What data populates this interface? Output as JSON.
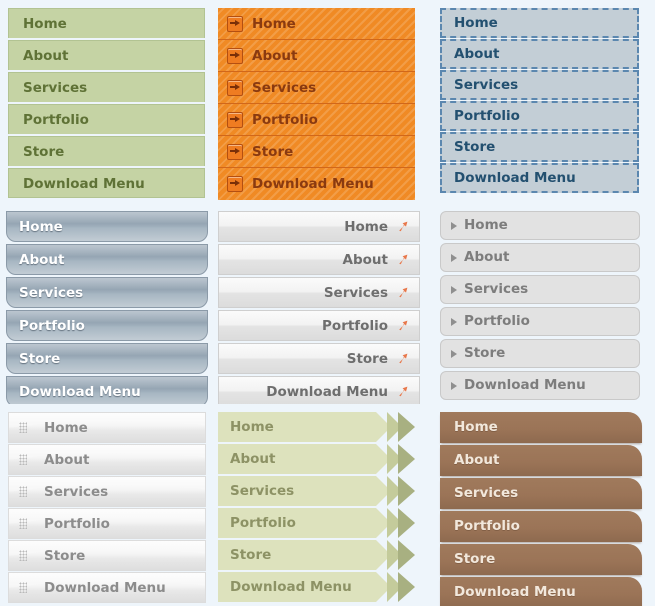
{
  "page": {
    "background_color": "#eef5fb",
    "layout": "3x3 grid of vertical navigation menu style variations"
  },
  "labels": [
    "Home",
    "About",
    "Services",
    "Portfolio",
    "Store",
    "Download Menu"
  ],
  "menus": [
    {
      "id": "sage-green-menu",
      "style_name": "sage-green",
      "colors": {
        "background": "#c5d3a4",
        "text": "#5f7236",
        "border": "#b2c392"
      },
      "icon": null,
      "align": "left",
      "items": [
        {
          "label": "Home"
        },
        {
          "label": "About"
        },
        {
          "label": "Services"
        },
        {
          "label": "Portfolio"
        },
        {
          "label": "Store"
        },
        {
          "label": "Download Menu"
        }
      ]
    },
    {
      "id": "orange-striped-menu",
      "style_name": "orange-striped",
      "colors": {
        "background": "#f08a24",
        "text": "#8a3a10",
        "border": "#d1671a"
      },
      "icon": "arrow-right-box-icon",
      "align": "left",
      "items": [
        {
          "label": "Home"
        },
        {
          "label": "About"
        },
        {
          "label": "Services"
        },
        {
          "label": "Portfolio"
        },
        {
          "label": "Store"
        },
        {
          "label": "Download Menu"
        }
      ]
    },
    {
      "id": "dashed-blue-menu",
      "style_name": "dashed-blue",
      "colors": {
        "background": "#c3ced6",
        "text": "#235070",
        "border": "#5b87af"
      },
      "icon": null,
      "align": "left",
      "items": [
        {
          "label": "Home"
        },
        {
          "label": "About"
        },
        {
          "label": "Services"
        },
        {
          "label": "Portfolio"
        },
        {
          "label": "Store"
        },
        {
          "label": "Download Menu"
        }
      ]
    },
    {
      "id": "steel-glossy-menu",
      "style_name": "steel-glossy",
      "colors": {
        "background": "#9eadbb",
        "text": "#ffffff",
        "border": "#8b9aa8"
      },
      "icon": null,
      "align": "left",
      "items": [
        {
          "label": "Home"
        },
        {
          "label": "About"
        },
        {
          "label": "Services"
        },
        {
          "label": "Portfolio"
        },
        {
          "label": "Store"
        },
        {
          "label": "Download Menu"
        }
      ]
    },
    {
      "id": "gray-right-arrow-menu",
      "style_name": "gray-right-aligned",
      "colors": {
        "background": "#f2f2f2",
        "text": "#6e6e6e",
        "border": "#cfcfcf",
        "accent": "#e8774a"
      },
      "icon": "diagonal-arrow-icon",
      "align": "right",
      "items": [
        {
          "label": "Home"
        },
        {
          "label": "About"
        },
        {
          "label": "Services"
        },
        {
          "label": "Portfolio"
        },
        {
          "label": "Store"
        },
        {
          "label": "Download Menu"
        }
      ]
    },
    {
      "id": "gray-triangle-menu",
      "style_name": "gray-rounded-triangle",
      "colors": {
        "background": "#e2e2e2",
        "text": "#7d7d7d",
        "border": "#c9c9c9"
      },
      "icon": "triangle-right-icon",
      "align": "left",
      "items": [
        {
          "label": "Home"
        },
        {
          "label": "About"
        },
        {
          "label": "Services"
        },
        {
          "label": "Portfolio"
        },
        {
          "label": "Store"
        },
        {
          "label": "Download Menu"
        }
      ]
    },
    {
      "id": "white-swoosh-menu",
      "style_name": "white-swoosh-grip",
      "colors": {
        "background": "#f7f7f7",
        "text": "#8c8c8c",
        "border": "#dcdcdc"
      },
      "icon": "grip-dots-icon",
      "align": "left",
      "items": [
        {
          "label": "Home"
        },
        {
          "label": "About"
        },
        {
          "label": "Services"
        },
        {
          "label": "Portfolio"
        },
        {
          "label": "Store"
        },
        {
          "label": "Download Menu"
        }
      ]
    },
    {
      "id": "green-chevron-menu",
      "style_name": "green-chevron",
      "colors": {
        "background": "#dde2bd",
        "text": "#8d9265",
        "chevron_mid": "#c4cb9b",
        "chevron_dark": "#a8b081"
      },
      "icon": "chevron-right-icon",
      "align": "left",
      "items": [
        {
          "label": "Home"
        },
        {
          "label": "About"
        },
        {
          "label": "Services"
        },
        {
          "label": "Portfolio"
        },
        {
          "label": "Store"
        },
        {
          "label": "Download Menu"
        }
      ]
    },
    {
      "id": "brown-rounded-menu",
      "style_name": "brown-rounded-corner",
      "colors": {
        "background": "#9b7457",
        "text": "#f2e8dc"
      },
      "icon": null,
      "align": "left",
      "items": [
        {
          "label": "Home"
        },
        {
          "label": "About"
        },
        {
          "label": "Services"
        },
        {
          "label": "Portfolio"
        },
        {
          "label": "Store"
        },
        {
          "label": "Download Menu"
        }
      ]
    }
  ]
}
